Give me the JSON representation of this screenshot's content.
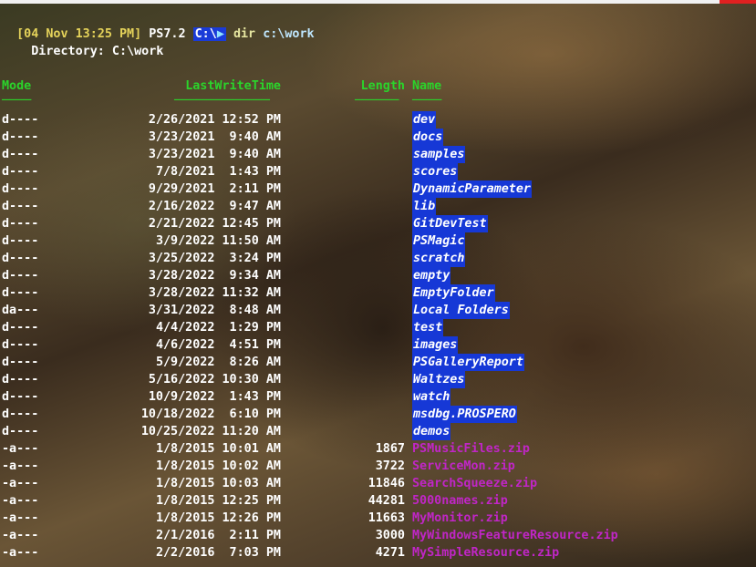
{
  "prompt": {
    "timestamp": "[04 Nov 13:25 PM]",
    "ps_version": "PS7.2",
    "path": "C:\\",
    "arrow": "▶",
    "command": "dir",
    "argument": "c:\\work"
  },
  "directory_label": "    Directory: C:\\work",
  "headers": {
    "mode": "Mode",
    "lastwritetime": "LastWriteTime",
    "length": "Length",
    "name": "Name"
  },
  "rows": [
    {
      "mode": "d----",
      "lwt": "2/26/2021 12:52 PM",
      "length": "",
      "name": "dev",
      "type": "dir"
    },
    {
      "mode": "d----",
      "lwt": "3/23/2021  9:40 AM",
      "length": "",
      "name": "docs",
      "type": "dir"
    },
    {
      "mode": "d----",
      "lwt": "3/23/2021  9:40 AM",
      "length": "",
      "name": "samples",
      "type": "dir"
    },
    {
      "mode": "d----",
      "lwt": "7/8/2021  1:43 PM",
      "length": "",
      "name": "scores",
      "type": "dir"
    },
    {
      "mode": "d----",
      "lwt": "9/29/2021  2:11 PM",
      "length": "",
      "name": "DynamicParameter",
      "type": "dir"
    },
    {
      "mode": "d----",
      "lwt": "2/16/2022  9:47 AM",
      "length": "",
      "name": "lib",
      "type": "dir"
    },
    {
      "mode": "d----",
      "lwt": "2/21/2022 12:45 PM",
      "length": "",
      "name": "GitDevTest",
      "type": "dir"
    },
    {
      "mode": "d----",
      "lwt": "3/9/2022 11:50 AM",
      "length": "",
      "name": "PSMagic",
      "type": "dir"
    },
    {
      "mode": "d----",
      "lwt": "3/25/2022  3:24 PM",
      "length": "",
      "name": "scratch",
      "type": "dir"
    },
    {
      "mode": "d----",
      "lwt": "3/28/2022  9:34 AM",
      "length": "",
      "name": "empty",
      "type": "dir"
    },
    {
      "mode": "d----",
      "lwt": "3/28/2022 11:32 AM",
      "length": "",
      "name": "EmptyFolder",
      "type": "dir"
    },
    {
      "mode": "da---",
      "lwt": "3/31/2022  8:48 AM",
      "length": "",
      "name": "Local Folders",
      "type": "dir"
    },
    {
      "mode": "d----",
      "lwt": "4/4/2022  1:29 PM",
      "length": "",
      "name": "test",
      "type": "dir"
    },
    {
      "mode": "d----",
      "lwt": "4/6/2022  4:51 PM",
      "length": "",
      "name": "images",
      "type": "dir"
    },
    {
      "mode": "d----",
      "lwt": "5/9/2022  8:26 AM",
      "length": "",
      "name": "PSGalleryReport",
      "type": "dir"
    },
    {
      "mode": "d----",
      "lwt": "5/16/2022 10:30 AM",
      "length": "",
      "name": "Waltzes",
      "type": "dir"
    },
    {
      "mode": "d----",
      "lwt": "10/9/2022  1:43 PM",
      "length": "",
      "name": "watch",
      "type": "dir"
    },
    {
      "mode": "d----",
      "lwt": "10/18/2022  6:10 PM",
      "length": "",
      "name": "msdbg.PROSPERO",
      "type": "dir"
    },
    {
      "mode": "d----",
      "lwt": "10/25/2022 11:20 AM",
      "length": "",
      "name": "demos",
      "type": "dir"
    },
    {
      "mode": "-a---",
      "lwt": "1/8/2015 10:01 AM",
      "length": "1867",
      "name": "PSMusicFiles.zip",
      "type": "zip"
    },
    {
      "mode": "-a---",
      "lwt": "1/8/2015 10:02 AM",
      "length": "3722",
      "name": "ServiceMon.zip",
      "type": "zip"
    },
    {
      "mode": "-a---",
      "lwt": "1/8/2015 10:03 AM",
      "length": "11846",
      "name": "SearchSqueeze.zip",
      "type": "zip"
    },
    {
      "mode": "-a---",
      "lwt": "1/8/2015 12:25 PM",
      "length": "44281",
      "name": "5000names.zip",
      "type": "zip"
    },
    {
      "mode": "-a---",
      "lwt": "1/8/2015 12:26 PM",
      "length": "11663",
      "name": "MyMonitor.zip",
      "type": "zip"
    },
    {
      "mode": "-a---",
      "lwt": "2/1/2016  2:11 PM",
      "length": "3000",
      "name": "MyWindowsFeatureResource.zip",
      "type": "zip"
    },
    {
      "mode": "-a---",
      "lwt": "2/2/2016  7:03 PM",
      "length": "4271",
      "name": "MySimpleResource.zip",
      "type": "zip"
    }
  ],
  "colors": {
    "header_green": "#2bd42b",
    "dir_highlight": "#1638d6",
    "zip_magenta": "#c026c6",
    "timestamp_yellow": "#e5d35a"
  }
}
